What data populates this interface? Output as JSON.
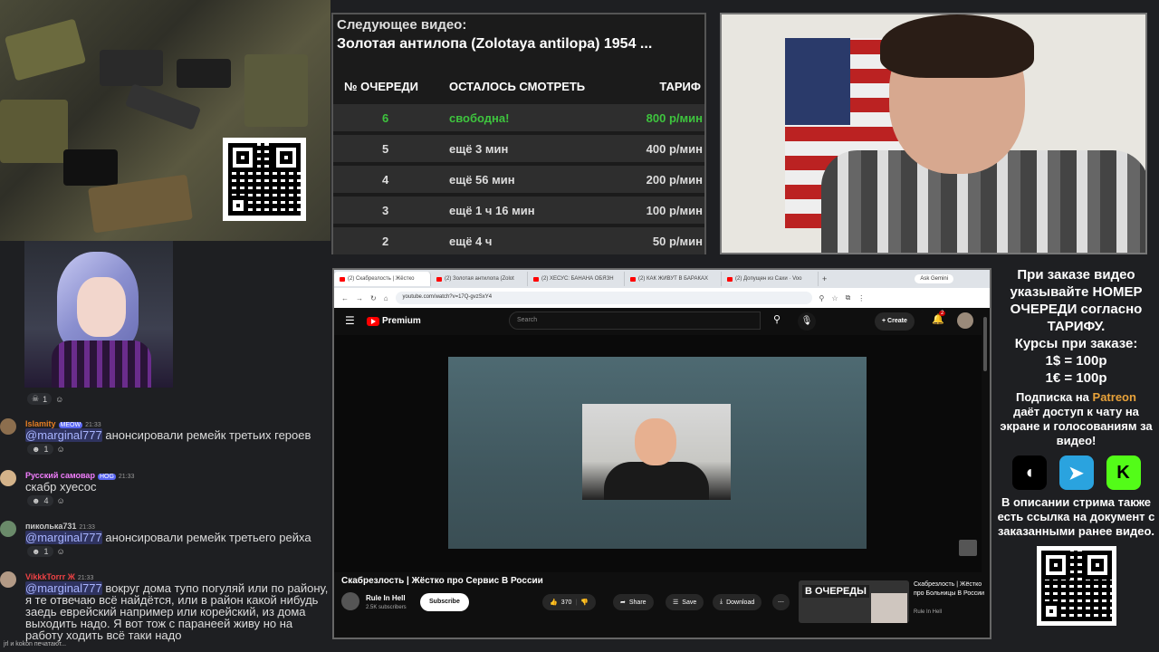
{
  "queue": {
    "next_label": "Следующее видео:",
    "next_title": "Золотая антилопа (Zolotaya antilopa) 1954 ...",
    "headers": [
      "№ ОЧЕРЕДИ",
      "ОСТАЛОСЬ СМОТРЕТЬ",
      "ТАРИФ"
    ],
    "rows": [
      {
        "num": "6",
        "remaining": "свободна!",
        "rate": "800 р/мин"
      },
      {
        "num": "5",
        "remaining": "ещё 3 мин",
        "rate": "400 р/мин"
      },
      {
        "num": "4",
        "remaining": "ещё 56 мин",
        "rate": "200 р/мин"
      },
      {
        "num": "3",
        "remaining": "ещё 1 ч 16 мин",
        "rate": "100 р/мин"
      },
      {
        "num": "2",
        "remaining": "ещё 4 ч",
        "rate": "50 р/мин"
      }
    ]
  },
  "chat": {
    "top_reaction": "1",
    "messages": [
      {
        "author": "Islamity",
        "badge": "MEOW",
        "time": "21:33",
        "mention": "@marginal777",
        "text": " анонсировали ремейк третьих героев",
        "reaction": "1",
        "author_color": "#e67e22"
      },
      {
        "author": "Русский самовар",
        "badge": "HOG",
        "time": "21:33",
        "mention": "",
        "text": "скабр хуесос",
        "reaction": "4",
        "author_color": "#f47fff"
      },
      {
        "author": "пиколька731",
        "badge": "",
        "time": "21:33",
        "mention": "@marginal777",
        "text": " анонсировали ремейк третьего рейха",
        "reaction": "1",
        "author_color": "#c9c9c9"
      },
      {
        "author": "VikkkTorrr Ж",
        "badge": "",
        "time": "21:33",
        "mention": "@marginal777",
        "text": " вокруг дома тупо погуляй или по району, я те отвечаю всё найдётся, или в район какой нибудь заедь еврейский например или корейский, из дома выходить надо. Я вот тож с паранеей живу но на работу ходить всё таки надо",
        "reaction": "",
        "author_color": "#ed4245"
      }
    ],
    "typing": "jrl и kokon печатают..."
  },
  "browser": {
    "tabs": [
      "(2) Скабрезлость | Жёстко",
      "(2) Золотая антилопа (Zolot",
      "(2) ХЕСУС: БАНАНА ОБЯЗН",
      "(2) КАК ЖИВУТ В БАРАКАХ",
      "(2) Допущен из Сахи · Voo"
    ],
    "gemini": "Ask Gemini",
    "url": "youtube.com/watch?v=17Q-gvzSxY4",
    "logo": "Premium",
    "search_placeholder": "Search",
    "create": "Create",
    "notif_count": "2",
    "video_title": "Скабрезлость | Жёстко про Сервис В России",
    "channel": "Rule In Hell",
    "subs": "2.5K subscribers",
    "subscribe": "Subscribe",
    "likes": "370",
    "share": "Share",
    "save": "Save",
    "download": "Download",
    "rec_thumb_text": "В ОЧЕРЕДЫ",
    "rec_title": "Скабрезлость | Жёстко про Больницы В России",
    "rec_channel": "Rule In Hell"
  },
  "info": {
    "order_text": [
      "При заказе видео",
      "указывайте НОМЕР",
      "ОЧЕРЕДИ согласно",
      "ТАРИФУ."
    ],
    "rates_title": "Курсы при заказе:",
    "rate_usd": "1$ = 100р",
    "rate_eur": "1€ = 100р",
    "sub_pre": "Подписка на ",
    "sub_link": "Patreon",
    "sub_post": "даёт доступ к чату на экране и голосованиям за видео!",
    "desc": "В описании стрима также есть ссылка на документ с заказанными ранее видео."
  },
  "colors": {
    "free_green": "#3ec43e",
    "patreon_orange": "#e8a23a",
    "yt_red": "#ff0000"
  }
}
